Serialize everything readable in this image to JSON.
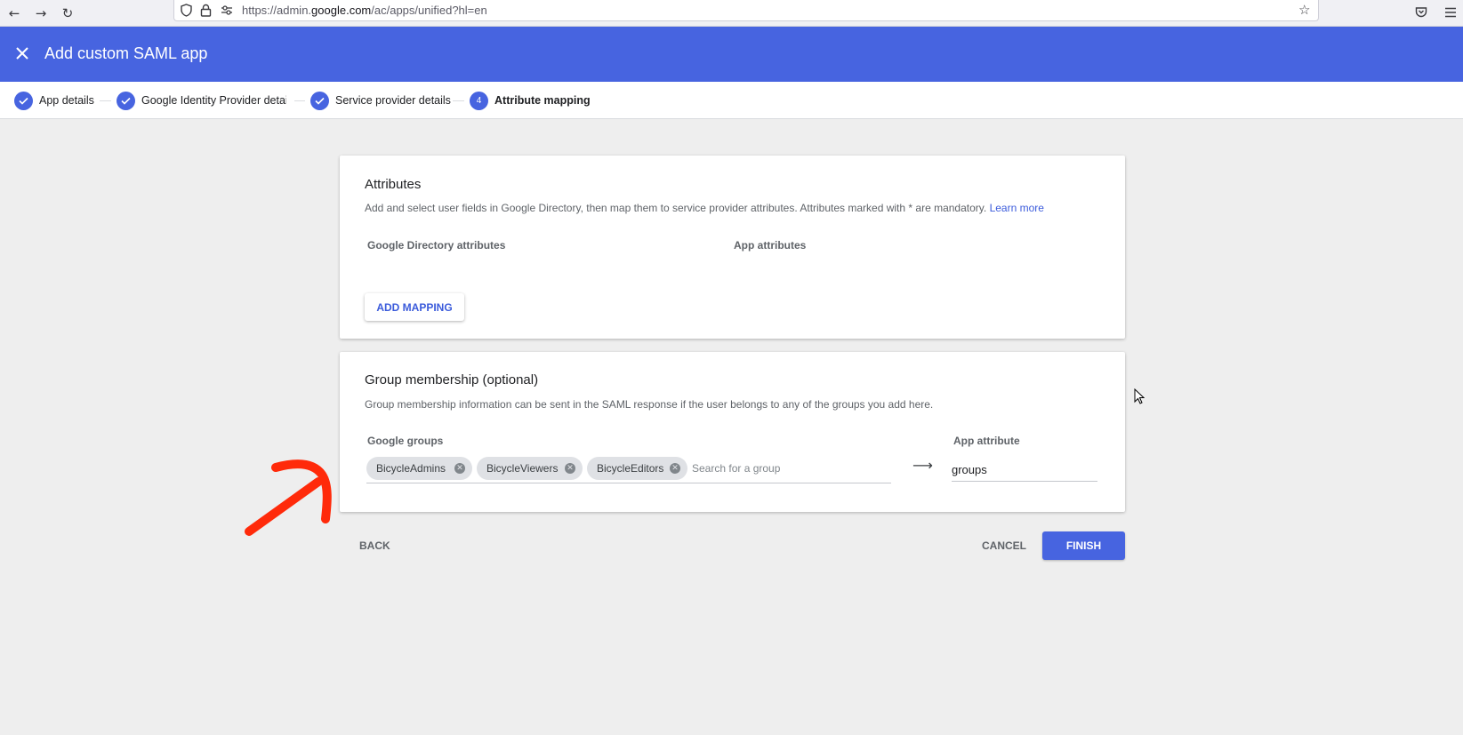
{
  "browser": {
    "url_prefix": "https://admin.",
    "url_domain": "google.com",
    "url_path": "/ac/apps/unified?hl=en"
  },
  "header": {
    "title": "Add custom SAML app",
    "color": "#4764e0"
  },
  "stepper": {
    "steps": [
      {
        "label": "App details",
        "status": "done"
      },
      {
        "label": "Google Identity Provider details",
        "status": "done"
      },
      {
        "label": "Service provider details",
        "status": "done"
      },
      {
        "label": "Attribute mapping",
        "status": "active",
        "number": "4"
      }
    ]
  },
  "attributes_card": {
    "title": "Attributes",
    "description": "Add and select user fields in Google Directory, then map them to service provider attributes. Attributes marked with * are mandatory.",
    "learn_more": "Learn more",
    "col_directory": "Google Directory attributes",
    "col_app": "App attributes",
    "add_mapping": "ADD MAPPING"
  },
  "group_card": {
    "title": "Group membership (optional)",
    "description": "Group membership information can be sent in the SAML response if the user belongs to any of the groups you add here.",
    "col_groups": "Google groups",
    "col_app_attr": "App attribute",
    "chips": [
      "BicycleAdmins",
      "BicycleViewers",
      "BicycleEditors"
    ],
    "search_placeholder": "Search for a group",
    "app_attribute_value": "groups"
  },
  "footer": {
    "back": "BACK",
    "cancel": "CANCEL",
    "finish": "FINISH"
  }
}
